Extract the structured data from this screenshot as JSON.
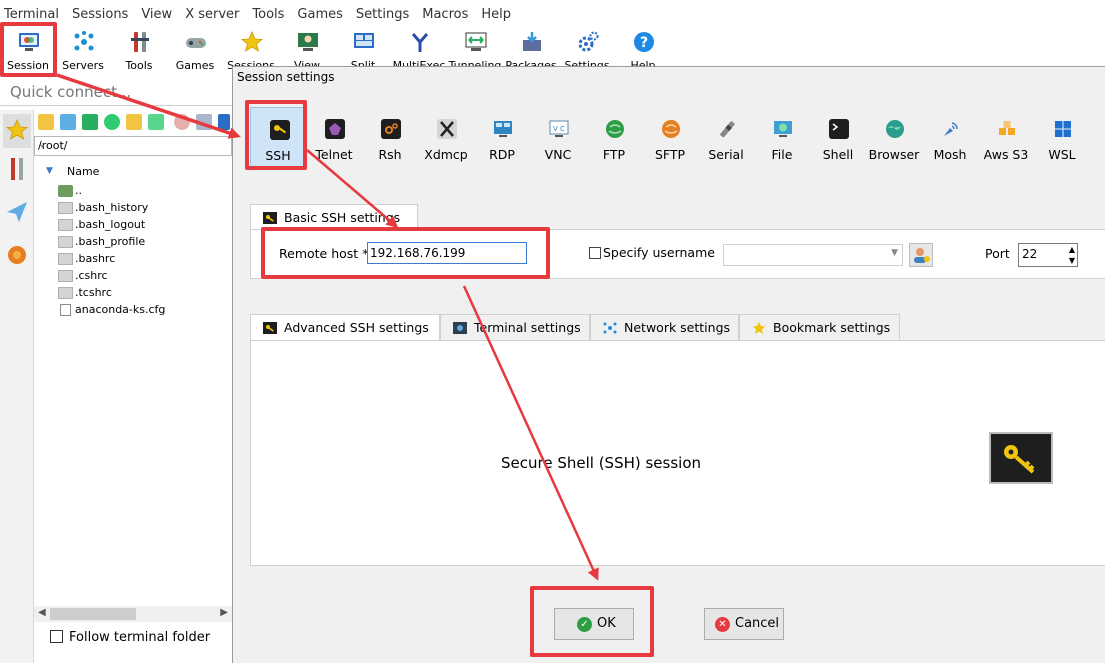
{
  "menu": [
    "Terminal",
    "Sessions",
    "View",
    "X server",
    "Tools",
    "Games",
    "Settings",
    "Macros",
    "Help"
  ],
  "toolbar": [
    {
      "label": "Session",
      "icon": "session-icon",
      "color": "#2b6cc4"
    },
    {
      "label": "Servers",
      "icon": "servers-icon",
      "color": "#1b8fd1"
    },
    {
      "label": "Tools",
      "icon": "tools-icon",
      "color": "#c0392b"
    },
    {
      "label": "Games",
      "icon": "games-icon",
      "color": "#7f8c8d"
    },
    {
      "label": "Sessions",
      "icon": "star-icon",
      "color": "#f1c40f"
    },
    {
      "label": "View",
      "icon": "view-icon",
      "color": "#2c7a4b"
    },
    {
      "label": "Split",
      "icon": "split-icon",
      "color": "#2b6cc4"
    },
    {
      "label": "MultiExec",
      "icon": "multiexec-icon",
      "color": "#2b4fa8"
    },
    {
      "label": "Tunneling",
      "icon": "tunneling-icon",
      "color": "#27ae60"
    },
    {
      "label": "Packages",
      "icon": "packages-icon",
      "color": "#5d6d9e"
    },
    {
      "label": "Settings",
      "icon": "gear-icon",
      "color": "#2b6cc4"
    },
    {
      "label": "Help",
      "icon": "help-icon",
      "color": "#1e88e5"
    }
  ],
  "quick_connect": "Quick connect...",
  "browser": {
    "path": "/root/",
    "column": "Name",
    "files": [
      {
        "name": "..",
        "type": "folder"
      },
      {
        "name": ".bash_history",
        "type": "dot"
      },
      {
        "name": ".bash_logout",
        "type": "dot"
      },
      {
        "name": ".bash_profile",
        "type": "dot"
      },
      {
        "name": ".bashrc",
        "type": "dot"
      },
      {
        "name": ".cshrc",
        "type": "dot"
      },
      {
        "name": ".tcshrc",
        "type": "dot"
      },
      {
        "name": "anaconda-ks.cfg",
        "type": "cfg"
      }
    ],
    "follow": "Follow terminal folder"
  },
  "dialog": {
    "title": "Session settings",
    "protocols": [
      {
        "label": "SSH",
        "icon": "key-icon",
        "color": "#1e1e1e"
      },
      {
        "label": "Telnet",
        "icon": "telnet-icon",
        "color": "#7d3c98"
      },
      {
        "label": "Rsh",
        "icon": "rsh-icon",
        "color": "#333333"
      },
      {
        "label": "Xdmcp",
        "icon": "xdmcp-icon",
        "color": "#555555"
      },
      {
        "label": "RDP",
        "icon": "rdp-icon",
        "color": "#2e86c1"
      },
      {
        "label": "VNC",
        "icon": "vnc-icon",
        "color": "#5d8aa8"
      },
      {
        "label": "FTP",
        "icon": "ftp-icon",
        "color": "#2e9e44"
      },
      {
        "label": "SFTP",
        "icon": "sftp-icon",
        "color": "#e67e22"
      },
      {
        "label": "Serial",
        "icon": "serial-icon",
        "color": "#888888"
      },
      {
        "label": "File",
        "icon": "file-icon",
        "color": "#3d9fd6"
      },
      {
        "label": "Shell",
        "icon": "shell-icon",
        "color": "#222222"
      },
      {
        "label": "Browser",
        "icon": "browser-icon",
        "color": "#2a9d8f"
      },
      {
        "label": "Mosh",
        "icon": "mosh-icon",
        "color": "#3f7fc4"
      },
      {
        "label": "Aws S3",
        "icon": "aws-s3-icon",
        "color": "#f5a623"
      },
      {
        "label": "WSL",
        "icon": "wsl-icon",
        "color": "#1f6fd1"
      }
    ],
    "basic_tab": "Basic SSH settings",
    "remote_host_label": "Remote host *",
    "remote_host_value": "192.168.76.199",
    "specify_username": "Specify username",
    "port_label": "Port",
    "port_value": "22",
    "lower_tabs": [
      {
        "label": "Advanced SSH settings",
        "icon": "key-icon"
      },
      {
        "label": "Terminal settings",
        "icon": "terminal-icon"
      },
      {
        "label": "Network settings",
        "icon": "network-icon"
      },
      {
        "label": "Bookmark settings",
        "icon": "star-icon"
      }
    ],
    "description": "Secure Shell (SSH) session",
    "ok": "OK",
    "cancel": "Cancel"
  },
  "colors": {
    "annotation": "#e63a3f",
    "selection": "#cfe4f7",
    "accent": "#3a7bd5"
  }
}
